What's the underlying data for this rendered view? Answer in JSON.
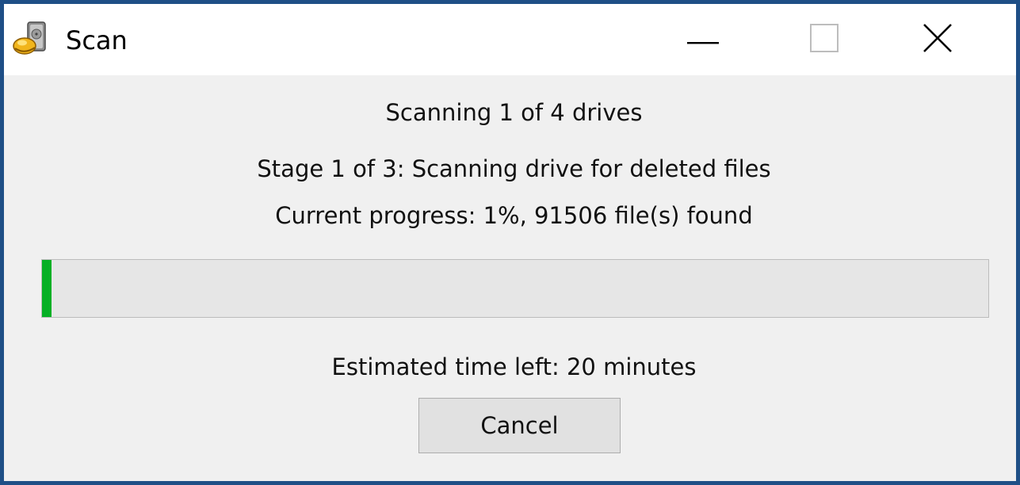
{
  "window": {
    "title": "Scan",
    "app_icon": "drive-recovery-icon",
    "controls": {
      "minimize_icon": "minimize-icon",
      "maximize_icon": "maximize-icon",
      "close_icon": "close-icon"
    }
  },
  "status": {
    "drives_line": "Scanning 1 of 4 drives",
    "stage_line": "Stage 1 of 3: Scanning drive for deleted files",
    "progress_line": "Current progress: 1%, 91506 file(s) found",
    "time_left_line": "Estimated time left: 20 minutes"
  },
  "progress": {
    "percent": 1,
    "fill_color": "#06b025"
  },
  "actions": {
    "cancel_label": "Cancel"
  }
}
